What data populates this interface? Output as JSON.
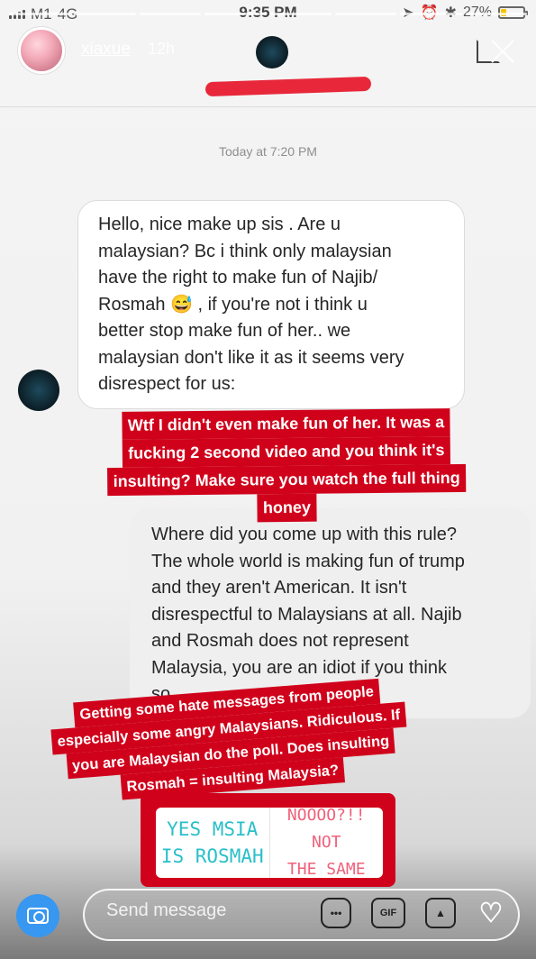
{
  "status_bar": {
    "carrier": "M1",
    "network": "4G",
    "time": "9:35 PM",
    "battery_percent": "27%",
    "battery_level": 0.27
  },
  "story": {
    "username": "xiaxue",
    "age": "12h",
    "progress_segments": 8
  },
  "thread": {
    "timestamp": "Today at 7:20 PM"
  },
  "messages": {
    "incoming": [
      "Hello, nice make up sis . Are u",
      "malaysian? Bc i think only malaysian",
      "have the right to make fun of Najib/",
      "Rosmah 😅 , if you're not i think u",
      "better stop make fun of her.. we",
      "malaysian don't like it as it seems very",
      "disrespect for us:"
    ],
    "outgoing": [
      "Where did you come up with this rule?",
      "The whole world is making fun of trump",
      "and they aren't American. It isn't",
      "disrespectful to Malaysians at all. Najib",
      "and Rosmah does not represent",
      "Malaysia, you are an idiot if you think",
      "so"
    ]
  },
  "captions": {
    "reply": [
      "Wtf I didn't even make fun of her. It was a",
      "fucking 2 second video and you think it's",
      "insulting? Make sure you watch the full thing",
      "honey"
    ],
    "poll_intro": [
      "Getting some hate messages from people",
      "especially some angry Malaysians. Ridiculous. If",
      "you are Malaysian do the poll. Does insulting",
      "Rosmah = insulting Malaysia?"
    ]
  },
  "poll": {
    "option_yes": [
      "YES MSIA",
      "IS ROSMAH"
    ],
    "option_no": [
      "NOOOO?!! NOT",
      "THE SAME"
    ]
  },
  "composer": {
    "placeholder": "Send message",
    "gif_label": "GIF"
  },
  "colors": {
    "caption_red": "#d0021b",
    "poll_yes": "#2abfc9",
    "poll_no": "#f0617a",
    "camera_blue": "#3897f0"
  }
}
